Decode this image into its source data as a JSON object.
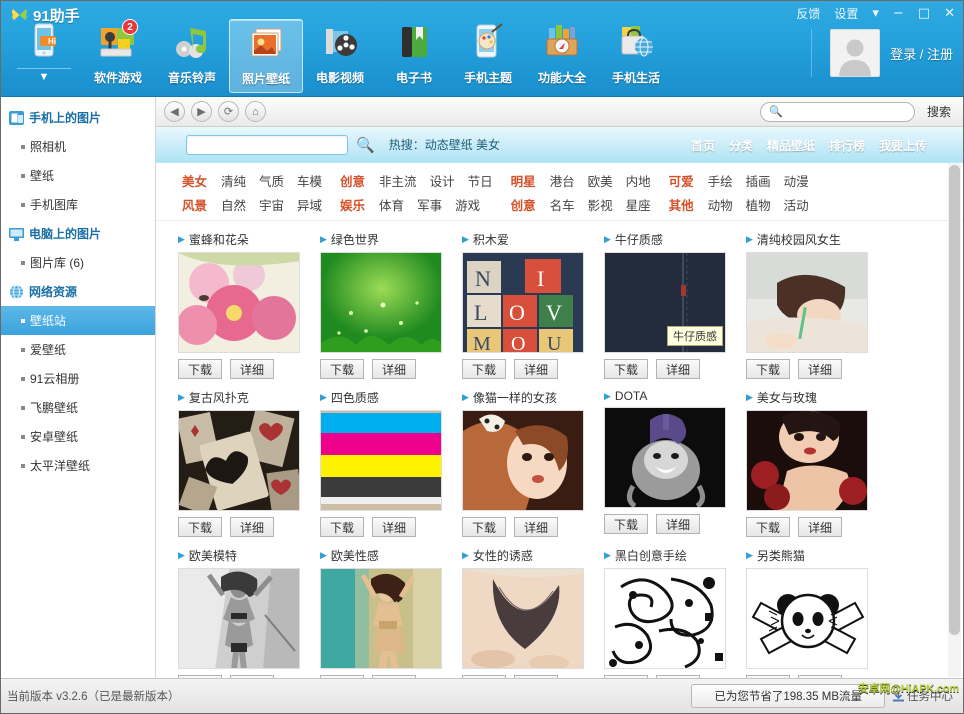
{
  "window": {
    "title": "91助手",
    "logo_icon": "butterfly-logo-icon",
    "feedback": "反馈",
    "settings": "设置",
    "dropdown_glyph": "▾",
    "minimize_glyph": "−",
    "maximize_glyph": "□",
    "close_glyph": "✕"
  },
  "nav": {
    "items": [
      {
        "label": "软件游戏",
        "icon": "apps-games-icon",
        "badge": "2",
        "active": false
      },
      {
        "label": "音乐铃声",
        "icon": "music-ringtone-icon",
        "badge": "",
        "active": false
      },
      {
        "label": "照片壁纸",
        "icon": "photo-wallpaper-icon",
        "badge": "",
        "active": true
      },
      {
        "label": "电影视频",
        "icon": "movie-video-icon",
        "badge": "",
        "active": false
      },
      {
        "label": "电子书",
        "icon": "ebook-icon",
        "badge": "",
        "active": false
      },
      {
        "label": "手机主题",
        "icon": "phone-theme-icon",
        "badge": "",
        "active": false
      },
      {
        "label": "功能大全",
        "icon": "toolbox-icon",
        "badge": "",
        "active": false
      },
      {
        "label": "手机生活",
        "icon": "phone-life-icon",
        "badge": "",
        "active": false
      }
    ]
  },
  "account": {
    "avatar_icon": "user-avatar-icon",
    "login_text": "登录 / 注册"
  },
  "sidebar": {
    "groups": [
      {
        "label": "手机上的图片",
        "icon": "phone-pictures-icon",
        "items": [
          {
            "label": "照相机",
            "selected": false
          },
          {
            "label": "壁纸",
            "selected": false
          },
          {
            "label": "手机图库",
            "selected": false
          }
        ]
      },
      {
        "label": "电脑上的图片",
        "icon": "computer-pictures-icon",
        "items": [
          {
            "label": "图片库 (6)",
            "selected": false
          }
        ]
      },
      {
        "label": "网络资源",
        "icon": "network-globe-icon",
        "items": [
          {
            "label": "壁纸站",
            "selected": true
          },
          {
            "label": "爱壁纸",
            "selected": false
          },
          {
            "label": "91云相册",
            "selected": false
          },
          {
            "label": "飞鹏壁纸",
            "selected": false
          },
          {
            "label": "安卓壁纸",
            "selected": false
          },
          {
            "label": "太平洋壁纸",
            "selected": false
          }
        ]
      }
    ]
  },
  "toolbar": {
    "back_icon": "back-arrow-icon",
    "forward_icon": "forward-arrow-icon",
    "refresh_icon": "refresh-icon",
    "home_icon": "home-icon",
    "search_icon": "search-icon",
    "search_value": "",
    "search_placeholder": "",
    "search_button": "搜索"
  },
  "site": {
    "search_value": "",
    "search_placeholder": "",
    "search_icon": "magnifier-icon",
    "hot_search": "热搜：动态壁纸 美女",
    "tabs": [
      "首页",
      "分类",
      "精品壁纸",
      "排行榜",
      "我要上传"
    ],
    "category_blocks": [
      {
        "rows": [
          {
            "head": "美女",
            "items": [
              "清纯",
              "气质",
              "车模"
            ]
          },
          {
            "head": "风景",
            "items": [
              "自然",
              "宇宙",
              "异域"
            ]
          }
        ]
      },
      {
        "rows": [
          {
            "head": "创意",
            "items": [
              "非主流",
              "设计",
              "节日"
            ]
          },
          {
            "head": "娱乐",
            "items": [
              "体育",
              "军事",
              "游戏"
            ]
          }
        ]
      },
      {
        "rows": [
          {
            "head": "明星",
            "items": [
              "港台",
              "欧美",
              "内地"
            ]
          },
          {
            "head": "创意",
            "items": [
              "名车",
              "影视",
              "星座"
            ]
          }
        ]
      },
      {
        "rows": [
          {
            "head": "可爱",
            "items": [
              "手绘",
              "插画",
              "动漫"
            ]
          },
          {
            "head": "其他",
            "items": [
              "动物",
              "植物",
              "活动"
            ]
          }
        ]
      }
    ],
    "download_label": "下载",
    "detail_label": "详细",
    "wallpapers": [
      {
        "title": "蜜蜂和花朵",
        "art": "flowers",
        "tooltip": ""
      },
      {
        "title": "绿色世界",
        "art": "green",
        "tooltip": ""
      },
      {
        "title": "积木爱",
        "art": "blocks",
        "tooltip": ""
      },
      {
        "title": "牛仔质感",
        "art": "denim",
        "tooltip": "牛仔质感"
      },
      {
        "title": "清纯校园风女生",
        "art": "campus",
        "tooltip": ""
      },
      {
        "title": "复古风扑克",
        "art": "poker",
        "tooltip": ""
      },
      {
        "title": "四色质感",
        "art": "fourcolor",
        "tooltip": ""
      },
      {
        "title": "像猫一样的女孩",
        "art": "catgirl",
        "tooltip": ""
      },
      {
        "title": "DOTA",
        "art": "dota",
        "tooltip": ""
      },
      {
        "title": "美女与玫瑰",
        "art": "rose",
        "tooltip": ""
      },
      {
        "title": "欧美模特",
        "art": "model",
        "tooltip": ""
      },
      {
        "title": "欧美性感",
        "art": "sexy",
        "tooltip": ""
      },
      {
        "title": "女性的诱惑",
        "art": "lace",
        "tooltip": ""
      },
      {
        "title": "黑白创意手绘",
        "art": "doodle",
        "tooltip": ""
      },
      {
        "title": "另类熊猫",
        "art": "panda",
        "tooltip": ""
      }
    ]
  },
  "status": {
    "version": "当前版本  v3.2.6（已是最新版本）",
    "saved_traffic": "已为您节省了198.35 MB流量",
    "task_center": "任务中心",
    "task_icon": "download-task-icon",
    "watermark": "安卓网@HiAPK.com"
  }
}
